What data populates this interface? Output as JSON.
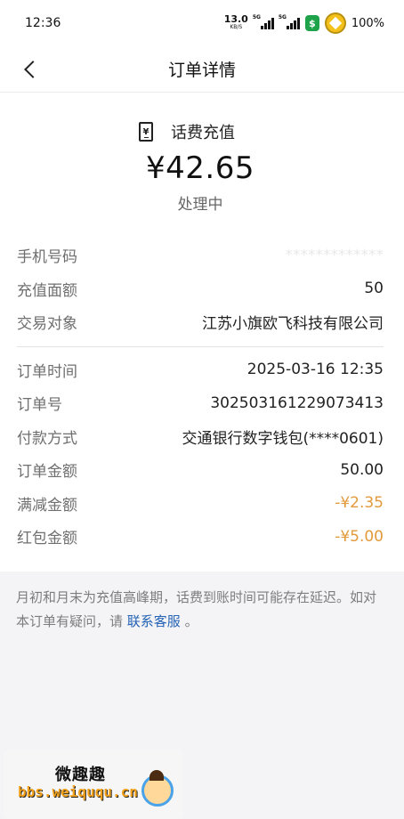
{
  "status_bar": {
    "time": "12:36",
    "net_speed": "13.0",
    "net_unit": "KB/S",
    "signal1_label": "5G",
    "signal2_label": "5G",
    "battery": "100%"
  },
  "nav": {
    "title": "订单详情"
  },
  "summary": {
    "product_icon_glyph": "¥",
    "product": "话费充值",
    "amount": "¥42.65",
    "status": "处理中"
  },
  "details_top": [
    {
      "key": "手机号码",
      "value": "*************"
    },
    {
      "key": "充值面额",
      "value": "50"
    },
    {
      "key": "交易对象",
      "value": "江苏小旗欧飞科技有限公司"
    }
  ],
  "details_bottom": [
    {
      "key": "订单时间",
      "value": "2025-03-16 12:35"
    },
    {
      "key": "订单号",
      "value": "302503161229073413"
    },
    {
      "key": "付款方式",
      "value": "交通银行数字钱包(****0601)"
    },
    {
      "key": "订单金额",
      "value": "50.00"
    },
    {
      "key": "满减金额",
      "value": "-¥2.35"
    },
    {
      "key": "红包金额",
      "value": "-¥5.00"
    }
  ],
  "notice": {
    "text": "月初和月末为充值高峰期，话费到账时间可能存在延迟。如对本订单有疑问，请 ",
    "link": "联系客服",
    "suffix": " 。"
  },
  "watermark": {
    "title": "微趣趣",
    "url": "bbs.weiququ.cn"
  },
  "colors": {
    "discount": "#e29a3c",
    "link": "#2463b5"
  }
}
